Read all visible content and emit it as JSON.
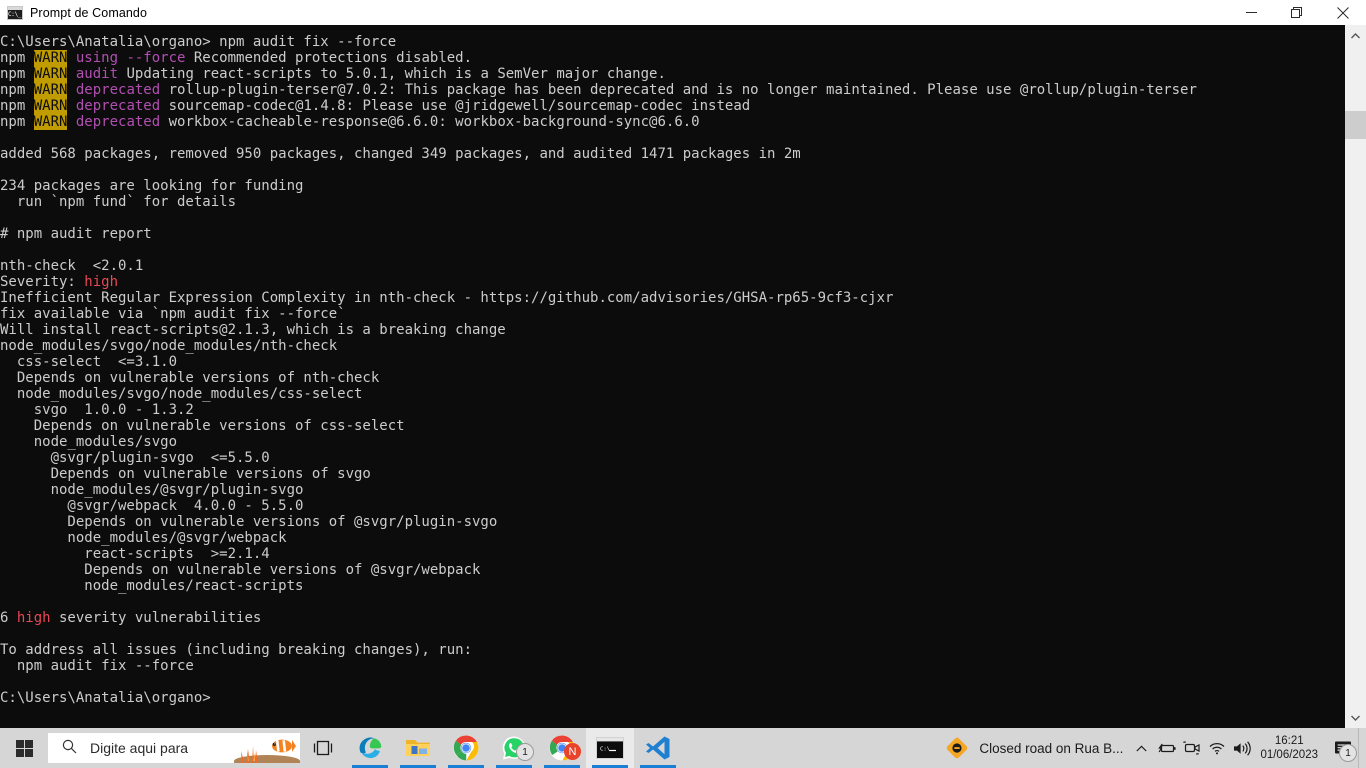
{
  "window": {
    "title": "Prompt de Comando",
    "icon": "cmd-icon",
    "icon_glyph": "C:\\_",
    "controls": {
      "minimize": "minimize-button",
      "maximize": "maximize-button",
      "close": "close-button"
    }
  },
  "console": {
    "background": "#0c0c0c",
    "foreground": "#cccccc",
    "warn_bg": "#c19c00",
    "magenta": "#b14fb1",
    "red": "#e74856",
    "lines": [
      {
        "segs": [
          {
            "t": "C:\\Users\\Anatalia\\organo> npm audit fix --force"
          }
        ]
      },
      {
        "segs": [
          {
            "t": "npm "
          },
          {
            "t": "WARN",
            "c": "warnbadge"
          },
          {
            "t": " "
          },
          {
            "t": "using --force",
            "c": "magenta"
          },
          {
            "t": " Recommended protections disabled."
          }
        ]
      },
      {
        "segs": [
          {
            "t": "npm "
          },
          {
            "t": "WARN",
            "c": "warnbadge"
          },
          {
            "t": " "
          },
          {
            "t": "audit",
            "c": "magenta"
          },
          {
            "t": " Updating react-scripts to 5.0.1, which is a SemVer major change."
          }
        ]
      },
      {
        "segs": [
          {
            "t": "npm "
          },
          {
            "t": "WARN",
            "c": "warnbadge"
          },
          {
            "t": " "
          },
          {
            "t": "deprecated",
            "c": "magenta"
          },
          {
            "t": " rollup-plugin-terser@7.0.2: This package has been deprecated and is no longer maintained. Please use @rollup/plugin-terser"
          }
        ]
      },
      {
        "segs": [
          {
            "t": "npm "
          },
          {
            "t": "WARN",
            "c": "warnbadge"
          },
          {
            "t": " "
          },
          {
            "t": "deprecated",
            "c": "magenta"
          },
          {
            "t": " sourcemap-codec@1.4.8: Please use @jridgewell/sourcemap-codec instead"
          }
        ]
      },
      {
        "segs": [
          {
            "t": "npm "
          },
          {
            "t": "WARN",
            "c": "warnbadge"
          },
          {
            "t": " "
          },
          {
            "t": "deprecated",
            "c": "magenta"
          },
          {
            "t": " workbox-cacheable-response@6.6.0: workbox-background-sync@6.6.0"
          }
        ]
      },
      {
        "segs": [
          {
            "t": ""
          }
        ]
      },
      {
        "segs": [
          {
            "t": "added 568 packages, removed 950 packages, changed 349 packages, and audited 1471 packages in 2m"
          }
        ]
      },
      {
        "segs": [
          {
            "t": ""
          }
        ]
      },
      {
        "segs": [
          {
            "t": "234 packages are looking for funding"
          }
        ]
      },
      {
        "segs": [
          {
            "t": "  run `npm fund` for details"
          }
        ]
      },
      {
        "segs": [
          {
            "t": ""
          }
        ]
      },
      {
        "segs": [
          {
            "t": "# npm audit report"
          }
        ]
      },
      {
        "segs": [
          {
            "t": ""
          }
        ]
      },
      {
        "segs": [
          {
            "t": "nth-check  <2.0.1"
          }
        ]
      },
      {
        "segs": [
          {
            "t": "Severity: "
          },
          {
            "t": "high",
            "c": "red"
          }
        ]
      },
      {
        "segs": [
          {
            "t": "Inefficient Regular Expression Complexity in nth-check - https://github.com/advisories/GHSA-rp65-9cf3-cjxr"
          }
        ]
      },
      {
        "segs": [
          {
            "t": "fix available via `npm audit fix --force`"
          }
        ]
      },
      {
        "segs": [
          {
            "t": "Will install react-scripts@2.1.3, which is a breaking change"
          }
        ]
      },
      {
        "segs": [
          {
            "t": "node_modules/svgo/node_modules/nth-check"
          }
        ]
      },
      {
        "segs": [
          {
            "t": "  css-select  <=3.1.0"
          }
        ]
      },
      {
        "segs": [
          {
            "t": "  Depends on vulnerable versions of nth-check"
          }
        ]
      },
      {
        "segs": [
          {
            "t": "  node_modules/svgo/node_modules/css-select"
          }
        ]
      },
      {
        "segs": [
          {
            "t": "    svgo  1.0.0 - 1.3.2"
          }
        ]
      },
      {
        "segs": [
          {
            "t": "    Depends on vulnerable versions of css-select"
          }
        ]
      },
      {
        "segs": [
          {
            "t": "    node_modules/svgo"
          }
        ]
      },
      {
        "segs": [
          {
            "t": "      @svgr/plugin-svgo  <=5.5.0"
          }
        ]
      },
      {
        "segs": [
          {
            "t": "      Depends on vulnerable versions of svgo"
          }
        ]
      },
      {
        "segs": [
          {
            "t": "      node_modules/@svgr/plugin-svgo"
          }
        ]
      },
      {
        "segs": [
          {
            "t": "        @svgr/webpack  4.0.0 - 5.5.0"
          }
        ]
      },
      {
        "segs": [
          {
            "t": "        Depends on vulnerable versions of @svgr/plugin-svgo"
          }
        ]
      },
      {
        "segs": [
          {
            "t": "        node_modules/@svgr/webpack"
          }
        ]
      },
      {
        "segs": [
          {
            "t": "          react-scripts  >=2.1.4"
          }
        ]
      },
      {
        "segs": [
          {
            "t": "          Depends on vulnerable versions of @svgr/webpack"
          }
        ]
      },
      {
        "segs": [
          {
            "t": "          node_modules/react-scripts"
          }
        ]
      },
      {
        "segs": [
          {
            "t": ""
          }
        ]
      },
      {
        "segs": [
          {
            "t": "6 "
          },
          {
            "t": "high",
            "c": "red"
          },
          {
            "t": " severity vulnerabilities"
          }
        ]
      },
      {
        "segs": [
          {
            "t": ""
          }
        ]
      },
      {
        "segs": [
          {
            "t": "To address all issues (including breaking changes), run:"
          }
        ]
      },
      {
        "segs": [
          {
            "t": "  npm audit fix --force"
          }
        ]
      },
      {
        "segs": [
          {
            "t": ""
          }
        ]
      },
      {
        "segs": [
          {
            "t": "C:\\Users\\Anatalia\\organo>"
          }
        ]
      }
    ]
  },
  "scrollbar": {
    "up_arrow": "scroll-up-arrow",
    "down_arrow": "scroll-down-arrow",
    "thumb": "scrollbar-thumb"
  },
  "taskbar": {
    "start": "start-button",
    "search": {
      "placeholder": "Digite aqui para",
      "icon": "search-icon"
    },
    "task_view": "task-view-button",
    "items": [
      {
        "name": "taskbar-item-edge",
        "label": "Microsoft Edge",
        "running": true,
        "badge": null,
        "active": false
      },
      {
        "name": "taskbar-item-file-explorer",
        "label": "Explorador de Arquivos",
        "running": true,
        "badge": null,
        "active": false
      },
      {
        "name": "taskbar-item-chrome",
        "label": "Google Chrome",
        "running": true,
        "badge": null,
        "active": false
      },
      {
        "name": "taskbar-item-whatsapp",
        "label": "WhatsApp",
        "running": true,
        "badge": "1",
        "active": false
      },
      {
        "name": "taskbar-item-chrome-app",
        "label": "Chrome App",
        "running": true,
        "badge": "N",
        "active": false
      },
      {
        "name": "taskbar-item-command-prompt",
        "label": "Prompt de Comando",
        "running": true,
        "badge": null,
        "active": true
      },
      {
        "name": "taskbar-item-vscode",
        "label": "Visual Studio Code",
        "running": true,
        "badge": null,
        "active": false
      }
    ],
    "tray": {
      "notification_text": "Closed road on Rua B...",
      "notification_icon": "waze-road-closed-icon",
      "overflow_icon": "show-hidden-icons-chevron",
      "icons": [
        {
          "name": "battery-icon"
        },
        {
          "name": "camera-icon"
        },
        {
          "name": "wifi-icon"
        },
        {
          "name": "volume-icon"
        }
      ],
      "clock": {
        "time": "16:21",
        "date": "01/06/2023"
      },
      "notifications_badge": "1",
      "show_desktop": "show-desktop-button"
    }
  }
}
